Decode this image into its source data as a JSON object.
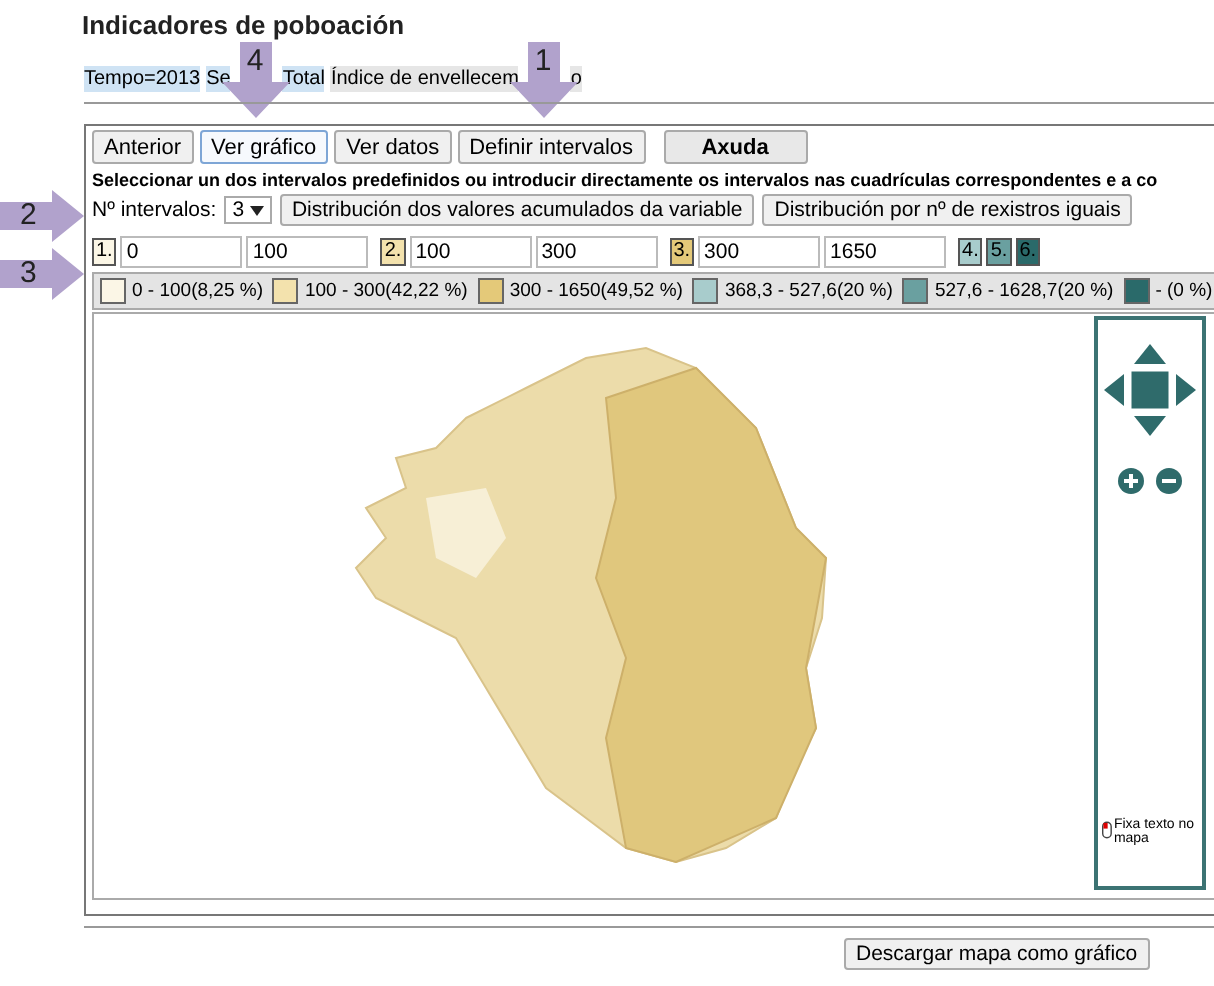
{
  "page_title": "Indicadores de poboación",
  "breadcrumb": [
    {
      "text": "Tempo=2013",
      "highlighted": true
    },
    {
      "text": "Se",
      "highlighted": true
    },
    {
      "text": "Total",
      "highlighted": true
    },
    {
      "text": "Índice de envellecem",
      "highlighted": false
    },
    {
      "text": "o",
      "highlighted": false
    }
  ],
  "callouts": [
    {
      "number": "4",
      "kind": "down"
    },
    {
      "number": "1",
      "kind": "down"
    },
    {
      "number": "2",
      "kind": "right"
    },
    {
      "number": "3",
      "kind": "right"
    }
  ],
  "toolbar": [
    {
      "label": "Anterior",
      "kind": "button",
      "selected": false
    },
    {
      "label": "Ver gráfico",
      "kind": "button",
      "selected": true
    },
    {
      "label": "Ver datos",
      "kind": "button",
      "selected": false
    },
    {
      "label": "Definir intervalos",
      "kind": "button",
      "selected": false
    },
    {
      "label": "Axuda",
      "kind": "help",
      "selected": false
    }
  ],
  "instruction": "Seleccionar un dos intervalos predefinidos ou introducir directamente os intervalos nas cuadrículas correspondentes e a co",
  "interval_count": {
    "label": "Nº intervalos:",
    "value": "3"
  },
  "distribution_buttons": [
    "Distribución dos valores acumulados da variable",
    "Distribución por nº de rexistros iguais"
  ],
  "intervals": [
    {
      "number": "1.",
      "kind": "range",
      "color": "#fbf6e6",
      "from": "0",
      "to": "100"
    },
    {
      "number": "2.",
      "kind": "range",
      "color": "#f3e2ad",
      "from": "100",
      "to": "300"
    },
    {
      "number": "3.",
      "kind": "range",
      "color": "#e4c979",
      "from": "300",
      "to": "1650"
    },
    {
      "number": "4.",
      "kind": "marker",
      "color": "#a8cccc"
    },
    {
      "number": "5.",
      "kind": "marker",
      "color": "#6aa0a0"
    },
    {
      "number": "6.",
      "kind": "marker",
      "color": "#2a6a6a"
    }
  ],
  "legend": [
    {
      "text": "0 - 100(8,25 %)",
      "color": "#fbf6e6"
    },
    {
      "text": "100 - 300(42,22 %)",
      "color": "#f3e2ad"
    },
    {
      "text": "300 - 1650(49,52 %)",
      "color": "#e4c979"
    },
    {
      "text": "368,3 - 527,6(20 %)",
      "color": "#a8cccc"
    },
    {
      "text": "527,6 - 1628,7(20 %)",
      "color": "#6aa0a0"
    },
    {
      "text": "- (0 %)",
      "color": "#2a6a6a"
    }
  ],
  "map_controls": {
    "fix_text_label": "Fixa texto no mapa"
  },
  "download_button": "Descargar mapa como gráfico"
}
